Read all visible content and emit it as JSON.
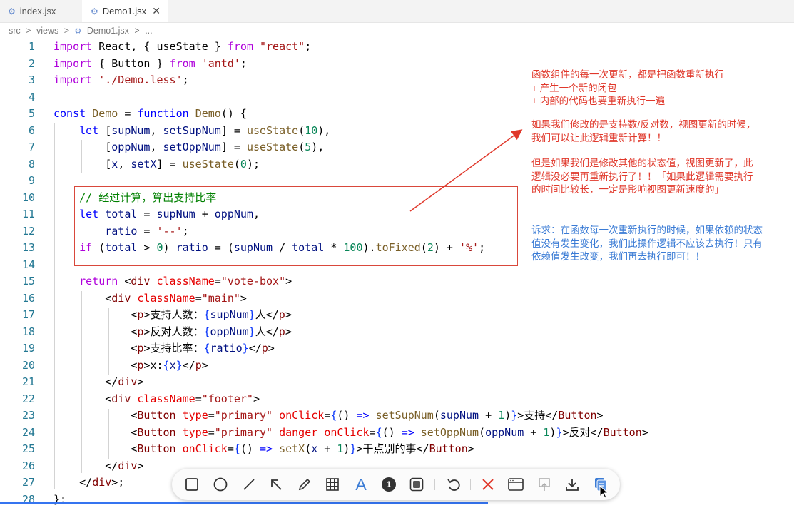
{
  "tabs": [
    {
      "label": "index.jsx",
      "icon": "gear-icon"
    },
    {
      "label": "Demo1.jsx",
      "icon": "gear-icon",
      "close": "✕"
    }
  ],
  "breadcrumb": {
    "p1": "src",
    "p2": "views",
    "p3": "Demo1.jsx",
    "p4": "...",
    "sep": ">"
  },
  "line_numbers": [
    "1",
    "2",
    "3",
    "4",
    "5",
    "6",
    "7",
    "8",
    "9",
    "10",
    "11",
    "12",
    "13",
    "14",
    "15",
    "16",
    "17",
    "18",
    "19",
    "20",
    "21",
    "22",
    "23",
    "24",
    "25",
    "26",
    "27",
    "28"
  ],
  "code": {
    "l1": [
      [
        "kw2",
        "import"
      ],
      [
        "jsx",
        " React, { useState } "
      ],
      [
        "kw2",
        "from"
      ],
      [
        "jsx",
        " "
      ],
      [
        "str",
        "\"react\""
      ],
      [
        "jsx",
        ";"
      ]
    ],
    "l2": [
      [
        "kw2",
        "import"
      ],
      [
        "jsx",
        " { Button } "
      ],
      [
        "kw2",
        "from"
      ],
      [
        "jsx",
        " "
      ],
      [
        "str",
        "'antd'"
      ],
      [
        "jsx",
        ";"
      ]
    ],
    "l3": [
      [
        "kw2",
        "import"
      ],
      [
        "jsx",
        " "
      ],
      [
        "str",
        "'./Demo.less'"
      ],
      [
        "jsx",
        ";"
      ]
    ],
    "l4": [],
    "l5": [
      [
        "kw",
        "const"
      ],
      [
        "jsx",
        " "
      ],
      [
        "fn",
        "Demo"
      ],
      [
        "jsx",
        " = "
      ],
      [
        "kw",
        "function"
      ],
      [
        "jsx",
        " "
      ],
      [
        "fn",
        "Demo"
      ],
      [
        "jsx",
        "() {"
      ]
    ],
    "l6": [
      [
        "jsx",
        "    "
      ],
      [
        "kw",
        "let"
      ],
      [
        "jsx",
        " ["
      ],
      [
        "var",
        "supNum"
      ],
      [
        "jsx",
        ", "
      ],
      [
        "var",
        "setSupNum"
      ],
      [
        "jsx",
        "] = "
      ],
      [
        "fn",
        "useState"
      ],
      [
        "jsx",
        "("
      ],
      [
        "num",
        "10"
      ],
      [
        "jsx",
        "),"
      ]
    ],
    "l7": [
      [
        "jsx",
        "        ["
      ],
      [
        "var",
        "oppNum"
      ],
      [
        "jsx",
        ", "
      ],
      [
        "var",
        "setOppNum"
      ],
      [
        "jsx",
        "] = "
      ],
      [
        "fn",
        "useState"
      ],
      [
        "jsx",
        "("
      ],
      [
        "num",
        "5"
      ],
      [
        "jsx",
        "),"
      ]
    ],
    "l8": [
      [
        "jsx",
        "        ["
      ],
      [
        "var",
        "x"
      ],
      [
        "jsx",
        ", "
      ],
      [
        "var",
        "setX"
      ],
      [
        "jsx",
        "] = "
      ],
      [
        "fn",
        "useState"
      ],
      [
        "jsx",
        "("
      ],
      [
        "num",
        "0"
      ],
      [
        "jsx",
        ");"
      ]
    ],
    "l9": [],
    "l10": [
      [
        "jsx",
        "    "
      ],
      [
        "cm",
        "// 经过计算，算出支持比率"
      ]
    ],
    "l11": [
      [
        "jsx",
        "    "
      ],
      [
        "kw",
        "let"
      ],
      [
        "jsx",
        " "
      ],
      [
        "var",
        "total"
      ],
      [
        "jsx",
        " = "
      ],
      [
        "var",
        "supNum"
      ],
      [
        "jsx",
        " + "
      ],
      [
        "var",
        "oppNum"
      ],
      [
        "jsx",
        ","
      ]
    ],
    "l12": [
      [
        "jsx",
        "        "
      ],
      [
        "var",
        "ratio"
      ],
      [
        "jsx",
        " = "
      ],
      [
        "str",
        "'--'"
      ],
      [
        "jsx",
        ";"
      ]
    ],
    "l13": [
      [
        "jsx",
        "    "
      ],
      [
        "kw2",
        "if"
      ],
      [
        "jsx",
        " ("
      ],
      [
        "var",
        "total"
      ],
      [
        "jsx",
        " > "
      ],
      [
        "num",
        "0"
      ],
      [
        "jsx",
        ") "
      ],
      [
        "var",
        "ratio"
      ],
      [
        "jsx",
        " = ("
      ],
      [
        "var",
        "supNum"
      ],
      [
        "jsx",
        " / "
      ],
      [
        "var",
        "total"
      ],
      [
        "jsx",
        " * "
      ],
      [
        "num",
        "100"
      ],
      [
        "jsx",
        ")."
      ],
      [
        "fn",
        "toFixed"
      ],
      [
        "jsx",
        "("
      ],
      [
        "num",
        "2"
      ],
      [
        "jsx",
        ") + "
      ],
      [
        "str",
        "'%'"
      ],
      [
        "jsx",
        ";"
      ]
    ],
    "l14": [],
    "l15": [
      [
        "jsx",
        "    "
      ],
      [
        "kw2",
        "return"
      ],
      [
        "jsx",
        " <"
      ],
      [
        "tag",
        "div"
      ],
      [
        "jsx",
        " "
      ],
      [
        "attr",
        "className"
      ],
      [
        "jsx",
        "="
      ],
      [
        "str",
        "\"vote-box\""
      ],
      [
        "jsx",
        ">"
      ]
    ],
    "l16": [
      [
        "jsx",
        "        <"
      ],
      [
        "tag",
        "div"
      ],
      [
        "jsx",
        " "
      ],
      [
        "attr",
        "className"
      ],
      [
        "jsx",
        "="
      ],
      [
        "str",
        "\"main\""
      ],
      [
        "jsx",
        ">"
      ]
    ],
    "l17": [
      [
        "jsx",
        "            <"
      ],
      [
        "tag",
        "p"
      ],
      [
        "jsx",
        ">支持人数："
      ],
      [
        "br",
        "{"
      ],
      [
        "var",
        "supNum"
      ],
      [
        "br",
        "}"
      ],
      [
        "jsx",
        "人</"
      ],
      [
        "tag",
        "p"
      ],
      [
        "jsx",
        ">"
      ]
    ],
    "l18": [
      [
        "jsx",
        "            <"
      ],
      [
        "tag",
        "p"
      ],
      [
        "jsx",
        ">反对人数："
      ],
      [
        "br",
        "{"
      ],
      [
        "var",
        "oppNum"
      ],
      [
        "br",
        "}"
      ],
      [
        "jsx",
        "人</"
      ],
      [
        "tag",
        "p"
      ],
      [
        "jsx",
        ">"
      ]
    ],
    "l19": [
      [
        "jsx",
        "            <"
      ],
      [
        "tag",
        "p"
      ],
      [
        "jsx",
        ">支持比率："
      ],
      [
        "br",
        "{"
      ],
      [
        "var",
        "ratio"
      ],
      [
        "br",
        "}"
      ],
      [
        "jsx",
        "</"
      ],
      [
        "tag",
        "p"
      ],
      [
        "jsx",
        ">"
      ]
    ],
    "l20": [
      [
        "jsx",
        "            <"
      ],
      [
        "tag",
        "p"
      ],
      [
        "jsx",
        ">x:"
      ],
      [
        "br",
        "{"
      ],
      [
        "var",
        "x"
      ],
      [
        "br",
        "}"
      ],
      [
        "jsx",
        "</"
      ],
      [
        "tag",
        "p"
      ],
      [
        "jsx",
        ">"
      ]
    ],
    "l21": [
      [
        "jsx",
        "        </"
      ],
      [
        "tag",
        "div"
      ],
      [
        "jsx",
        ">"
      ]
    ],
    "l22": [
      [
        "jsx",
        "        <"
      ],
      [
        "tag",
        "div"
      ],
      [
        "jsx",
        " "
      ],
      [
        "attr",
        "className"
      ],
      [
        "jsx",
        "="
      ],
      [
        "str",
        "\"footer\""
      ],
      [
        "jsx",
        ">"
      ]
    ],
    "l23": [
      [
        "jsx",
        "            <"
      ],
      [
        "tag",
        "Button"
      ],
      [
        "jsx",
        " "
      ],
      [
        "attr",
        "type"
      ],
      [
        "jsx",
        "="
      ],
      [
        "str",
        "\"primary\""
      ],
      [
        "jsx",
        " "
      ],
      [
        "attr",
        "onClick"
      ],
      [
        "jsx",
        "="
      ],
      [
        "br",
        "{"
      ],
      [
        "jsx",
        "() "
      ],
      [
        "kw",
        "=>"
      ],
      [
        "jsx",
        " "
      ],
      [
        "fn",
        "setSupNum"
      ],
      [
        "jsx",
        "("
      ],
      [
        "var",
        "supNum"
      ],
      [
        "jsx",
        " + "
      ],
      [
        "num",
        "1"
      ],
      [
        "jsx",
        ")"
      ],
      [
        "br",
        "}"
      ],
      [
        "jsx",
        ">支持</"
      ],
      [
        "tag",
        "Button"
      ],
      [
        "jsx",
        ">"
      ]
    ],
    "l24": [
      [
        "jsx",
        "            <"
      ],
      [
        "tag",
        "Button"
      ],
      [
        "jsx",
        " "
      ],
      [
        "attr",
        "type"
      ],
      [
        "jsx",
        "="
      ],
      [
        "str",
        "\"primary\""
      ],
      [
        "jsx",
        " "
      ],
      [
        "attr",
        "danger"
      ],
      [
        "jsx",
        " "
      ],
      [
        "attr",
        "onClick"
      ],
      [
        "jsx",
        "="
      ],
      [
        "br",
        "{"
      ],
      [
        "jsx",
        "() "
      ],
      [
        "kw",
        "=>"
      ],
      [
        "jsx",
        " "
      ],
      [
        "fn",
        "setOppNum"
      ],
      [
        "jsx",
        "("
      ],
      [
        "var",
        "oppNum"
      ],
      [
        "jsx",
        " + "
      ],
      [
        "num",
        "1"
      ],
      [
        "jsx",
        ")"
      ],
      [
        "br",
        "}"
      ],
      [
        "jsx",
        ">反对</"
      ],
      [
        "tag",
        "Button"
      ],
      [
        "jsx",
        ">"
      ]
    ],
    "l25": [
      [
        "jsx",
        "            <"
      ],
      [
        "tag",
        "Button"
      ],
      [
        "jsx",
        " "
      ],
      [
        "attr",
        "onClick"
      ],
      [
        "jsx",
        "="
      ],
      [
        "br",
        "{"
      ],
      [
        "jsx",
        "() "
      ],
      [
        "kw",
        "=>"
      ],
      [
        "jsx",
        " "
      ],
      [
        "fn",
        "setX"
      ],
      [
        "jsx",
        "("
      ],
      [
        "var",
        "x"
      ],
      [
        "jsx",
        " + "
      ],
      [
        "num",
        "1"
      ],
      [
        "jsx",
        ")"
      ],
      [
        "br",
        "}"
      ],
      [
        "jsx",
        ">干点别的事</"
      ],
      [
        "tag",
        "Button"
      ],
      [
        "jsx",
        ">"
      ]
    ],
    "l26": [
      [
        "jsx",
        "        </"
      ],
      [
        "tag",
        "div"
      ],
      [
        "jsx",
        ">"
      ]
    ],
    "l27": [
      [
        "jsx",
        "    </"
      ],
      [
        "tag",
        "div"
      ],
      [
        "jsx",
        ">;"
      ]
    ],
    "l28": [
      [
        "jsx",
        "};"
      ]
    ]
  },
  "annotations": {
    "red1": "函数组件的每一次更新，都是把函数重新执行\n+ 产生一个新的闭包\n+ 内部的代码也要重新执行一遍",
    "red2": "如果我们修改的是支持数/反对数，视图更新的时候，\n我们可以让此逻辑重新计算！！",
    "red3": "但是如果我们是修改其他的状态值，视图更新了，此\n逻辑没必要再重新执行了！！「如果此逻辑需要执行\n的时间比较长，一定是影响视图更新速度的」",
    "blue": "诉求：在函数每一次重新执行的时候，如果依赖的状态\n值没有发生变化，我们此操作逻辑不应该去执行！只有\n依赖值发生改变，我们再去执行即可！！"
  },
  "toolbar": {
    "tools": [
      "rectangle-icon",
      "circle-icon",
      "line-icon",
      "arrow-icon",
      "pencil-icon",
      "mosaic-icon",
      "text-icon",
      "number-icon",
      "border-icon",
      "undo-icon",
      "cancel-icon",
      "window-icon",
      "pin-icon",
      "download-icon",
      "copy-icon"
    ],
    "text_tool_glyph": "A",
    "number_tool_glyph": "1"
  },
  "colors": {
    "annotation_red": "#e0382b",
    "annotation_blue": "#3a7bd5",
    "accent": "#3574f0"
  }
}
